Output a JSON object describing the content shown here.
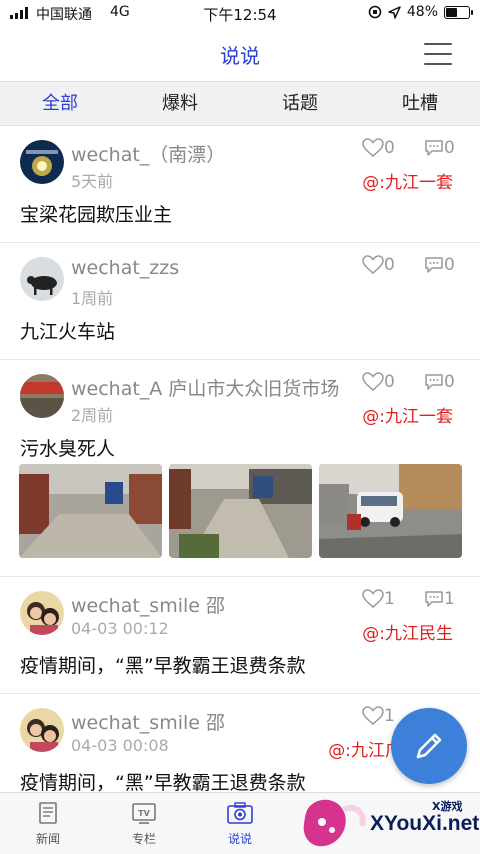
{
  "status_bar": {
    "carrier": "中国联通",
    "network": "4G",
    "time": "下午12:54",
    "battery": "48%",
    "battery_level": 0.48
  },
  "nav": {
    "title": "说说",
    "menu_icon": "hamburger-menu-icon"
  },
  "tabs": [
    {
      "label": "全部",
      "active": true
    },
    {
      "label": "爆料",
      "active": false
    },
    {
      "label": "话题",
      "active": false
    },
    {
      "label": "吐槽",
      "active": false
    }
  ],
  "posts": [
    {
      "username": "wechat_（南漂）",
      "time": "5天前",
      "likes": "0",
      "comments": "0",
      "tag": "@:九江一套",
      "content": "宝梁花园欺压业主"
    },
    {
      "username": "wechat_zzs",
      "time": "1周前",
      "likes": "0",
      "comments": "0",
      "tag": "",
      "content": "九江火车站"
    },
    {
      "username": "wechat_A 庐山市大众旧货市场",
      "time": "2周前",
      "likes": "0",
      "comments": "0",
      "tag": "@:九江一套",
      "content": "污水臭死人"
    },
    {
      "username": "wechat_smile 邵",
      "time": "04-03 00:12",
      "likes": "1",
      "comments": "1",
      "tag": "@:九江民生",
      "content": "疫情期间，“黑”早教霸王退费条款"
    },
    {
      "username": "wechat_smile 邵",
      "time": "04-03 00:08",
      "likes": "1",
      "comments": "",
      "tag": "@:九江广",
      "content": "疫情期间，“黑”早教霸王退费条款"
    }
  ],
  "bottom_nav": [
    {
      "label": "新闻",
      "icon": "news-icon",
      "active": false
    },
    {
      "label": "专栏",
      "icon": "tv-icon",
      "active": false
    },
    {
      "label": "说说",
      "icon": "camera-icon",
      "active": true
    }
  ],
  "fab": {
    "icon": "pencil-icon"
  },
  "watermark": {
    "site": "XYouXi.net",
    "small": "X游戏"
  },
  "colors": {
    "accent": "#2b3fd6",
    "tag_red": "#e02020",
    "fab": "#3d80d9"
  }
}
